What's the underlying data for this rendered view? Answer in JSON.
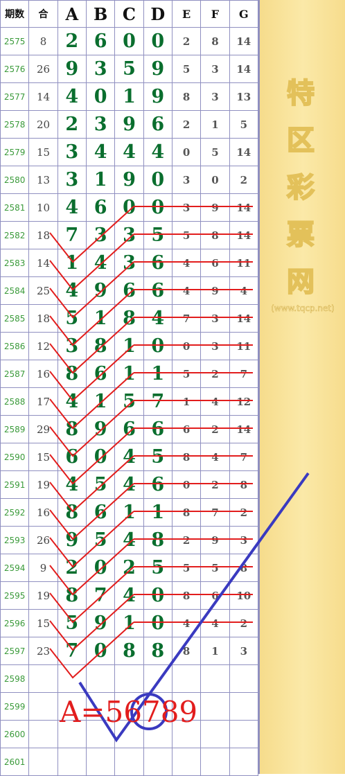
{
  "headers": {
    "period": "期数",
    "sum": "合",
    "A": "A",
    "B": "B",
    "C": "C",
    "D": "D",
    "E": "E",
    "F": "F",
    "G": "G"
  },
  "rows": [
    {
      "p": "2575",
      "s": "8",
      "a": "2",
      "b": "6",
      "c": "0",
      "d": "0",
      "e": "2",
      "f": "8",
      "g": "14"
    },
    {
      "p": "2576",
      "s": "26",
      "a": "9",
      "b": "3",
      "c": "5",
      "d": "9",
      "e": "5",
      "f": "3",
      "g": "14"
    },
    {
      "p": "2577",
      "s": "14",
      "a": "4",
      "b": "0",
      "c": "1",
      "d": "9",
      "e": "8",
      "f": "3",
      "g": "13"
    },
    {
      "p": "2578",
      "s": "20",
      "a": "2",
      "b": "3",
      "c": "9",
      "d": "6",
      "e": "2",
      "f": "1",
      "g": "5"
    },
    {
      "p": "2579",
      "s": "15",
      "a": "3",
      "b": "4",
      "c": "4",
      "d": "4",
      "e": "0",
      "f": "5",
      "g": "14"
    },
    {
      "p": "2580",
      "s": "13",
      "a": "3",
      "b": "1",
      "c": "9",
      "d": "0",
      "e": "3",
      "f": "0",
      "g": "2"
    },
    {
      "p": "2581",
      "s": "10",
      "a": "4",
      "b": "6",
      "c": "0",
      "d": "0",
      "e": "3",
      "f": "9",
      "g": "14"
    },
    {
      "p": "2582",
      "s": "18",
      "a": "7",
      "b": "3",
      "c": "3",
      "d": "5",
      "e": "5",
      "f": "8",
      "g": "14"
    },
    {
      "p": "2583",
      "s": "14",
      "a": "1",
      "b": "4",
      "c": "3",
      "d": "6",
      "e": "4",
      "f": "6",
      "g": "11"
    },
    {
      "p": "2584",
      "s": "25",
      "a": "4",
      "b": "9",
      "c": "6",
      "d": "6",
      "e": "4",
      "f": "9",
      "g": "4"
    },
    {
      "p": "2585",
      "s": "18",
      "a": "5",
      "b": "1",
      "c": "8",
      "d": "4",
      "e": "7",
      "f": "3",
      "g": "14"
    },
    {
      "p": "2586",
      "s": "12",
      "a": "3",
      "b": "8",
      "c": "1",
      "d": "0",
      "e": "0",
      "f": "3",
      "g": "11"
    },
    {
      "p": "2587",
      "s": "16",
      "a": "8",
      "b": "6",
      "c": "1",
      "d": "1",
      "e": "5",
      "f": "2",
      "g": "7"
    },
    {
      "p": "2588",
      "s": "17",
      "a": "4",
      "b": "1",
      "c": "5",
      "d": "7",
      "e": "1",
      "f": "4",
      "g": "12"
    },
    {
      "p": "2589",
      "s": "29",
      "a": "8",
      "b": "9",
      "c": "6",
      "d": "6",
      "e": "6",
      "f": "2",
      "g": "14"
    },
    {
      "p": "2590",
      "s": "15",
      "a": "6",
      "b": "0",
      "c": "4",
      "d": "5",
      "e": "8",
      "f": "4",
      "g": "7"
    },
    {
      "p": "2591",
      "s": "19",
      "a": "4",
      "b": "5",
      "c": "4",
      "d": "6",
      "e": "0",
      "f": "2",
      "g": "8"
    },
    {
      "p": "2592",
      "s": "16",
      "a": "8",
      "b": "6",
      "c": "1",
      "d": "1",
      "e": "8",
      "f": "7",
      "g": "2"
    },
    {
      "p": "2593",
      "s": "26",
      "a": "9",
      "b": "5",
      "c": "4",
      "d": "8",
      "e": "2",
      "f": "9",
      "g": "3"
    },
    {
      "p": "2594",
      "s": "9",
      "a": "2",
      "b": "0",
      "c": "2",
      "d": "5",
      "e": "5",
      "f": "5",
      "g": "8"
    },
    {
      "p": "2595",
      "s": "19",
      "a": "8",
      "b": "7",
      "c": "4",
      "d": "0",
      "e": "8",
      "f": "6",
      "g": "10"
    },
    {
      "p": "2596",
      "s": "15",
      "a": "5",
      "b": "9",
      "c": "1",
      "d": "0",
      "e": "4",
      "f": "4",
      "g": "2"
    },
    {
      "p": "2597",
      "s": "23",
      "a": "7",
      "b": "0",
      "c": "8",
      "d": "8",
      "e": "8",
      "f": "1",
      "g": "3"
    },
    {
      "p": "2598",
      "s": "",
      "a": "",
      "b": "",
      "c": "",
      "d": "",
      "e": "",
      "f": "",
      "g": ""
    },
    {
      "p": "2599",
      "s": "",
      "a": "",
      "b": "",
      "c": "",
      "d": "",
      "e": "",
      "f": "",
      "g": ""
    },
    {
      "p": "2600",
      "s": "",
      "a": "",
      "b": "",
      "c": "",
      "d": "",
      "e": "",
      "f": "",
      "g": ""
    },
    {
      "p": "2601",
      "s": "",
      "a": "",
      "b": "",
      "c": "",
      "d": "",
      "e": "",
      "f": "",
      "g": ""
    }
  ],
  "brand": {
    "chars": [
      "特",
      "区",
      "彩",
      "票",
      "网"
    ],
    "url": "(www.tqcp.net)"
  },
  "note": "A=56789",
  "colors": {
    "big_digit": "#0a6e2e",
    "period": "#3a9a3a",
    "red_line": "#e21d1d",
    "blue_line": "#3a3ac0",
    "side_bg": "#f6dc8c"
  }
}
